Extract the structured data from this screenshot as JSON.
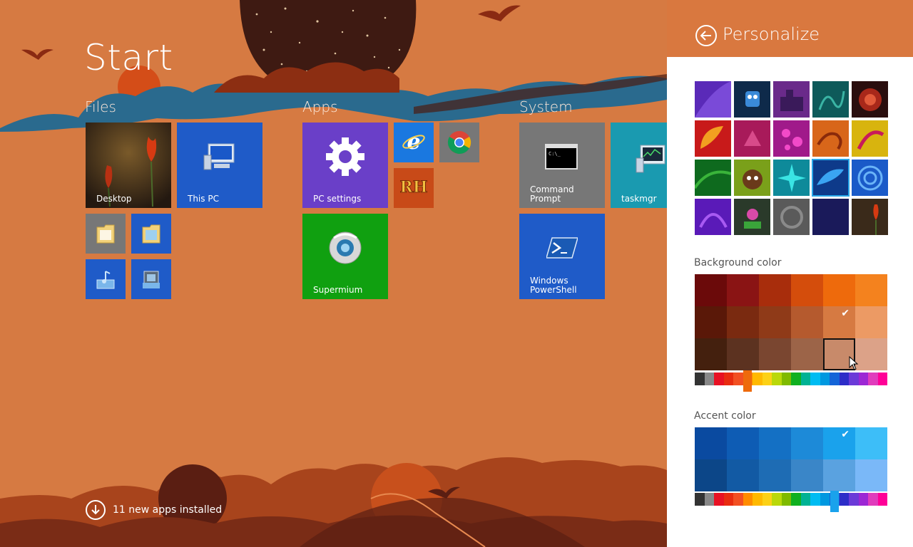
{
  "start": {
    "title": "Start",
    "groups": {
      "files": "Files",
      "apps": "Apps",
      "system": "System"
    },
    "tiles": {
      "desktop": "Desktop",
      "this_pc": "This PC",
      "pc_settings": "PC settings",
      "rh": "RH",
      "supermium": "Supermium",
      "command_prompt": "Command\nPrompt",
      "taskmgr": "taskmgr",
      "powershell": "Windows\nPowerShell"
    },
    "notification": "11 new apps installed"
  },
  "pane": {
    "title": "Personalize",
    "background_label": "Background color",
    "accent_label": "Accent color",
    "background_colors": [
      [
        "#6b0a0a",
        "#8a1414",
        "#a82d0c",
        "#d44d0c",
        "#ee6a0c",
        "#f4821e"
      ],
      [
        "#5a1808",
        "#7a2a10",
        "#8f3a18",
        "#b55a2e",
        "#d67a42",
        "#ec9a64"
      ],
      [
        "#44200e",
        "#5c3220",
        "#7a4630",
        "#9c6448",
        "#c88a6a",
        "#dca288"
      ]
    ],
    "background_selected": "1-4",
    "background_hover": "2-4",
    "accent_colors": [
      [
        "#0a4aa0",
        "#0e5cb4",
        "#1470c4",
        "#1d8ad8",
        "#1aa2ec",
        "#3dbef8"
      ],
      [
        "#0c4688",
        "#125aa4",
        "#1e6cb4",
        "#3a86c8",
        "#5aa2e0",
        "#7ab8f8"
      ]
    ],
    "accent_selected": "0-4",
    "hues": [
      "#333333",
      "#888888",
      "#e81123",
      "#e82c10",
      "#f25022",
      "#ff8c00",
      "#ffb900",
      "#fcd116",
      "#bad80a",
      "#7fba00",
      "#10b020",
      "#00b294",
      "#00bcf2",
      "#0098e0",
      "#1464d8",
      "#2d2dc8",
      "#6b3ad8",
      "#9c27d4",
      "#e03cbc",
      "#ff0097"
    ],
    "bg_hue_index": 5,
    "accent_hue_index": 14,
    "accent_hue_color": "#1aa2ec",
    "bg_hue_color": "#ee6a0c"
  }
}
